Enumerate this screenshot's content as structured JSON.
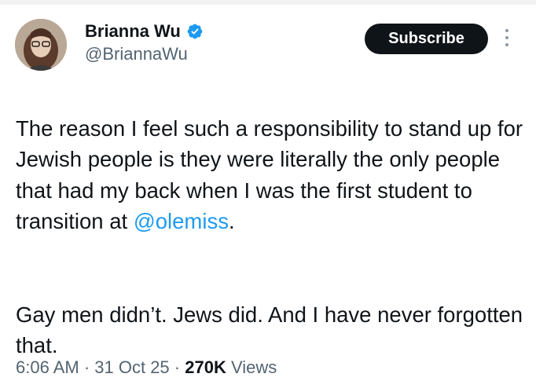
{
  "author": {
    "name": "Brianna Wu",
    "handle": "@BriannaWu",
    "verified_icon": "verified-badge-icon",
    "verified_color": "#1d9bf0"
  },
  "actions": {
    "subscribe_label": "Subscribe",
    "more_icon": "more-vertical-icon"
  },
  "tweet": {
    "para1_text": "The reason I feel such a responsibility to stand up for Jewish people is they were literally the only people that had my back when I was the first student to transition at ",
    "mention": "@olemiss",
    "para1_end": ".",
    "para2_text": "Gay men didn’t. Jews did. And I have never forgotten that."
  },
  "meta": {
    "time": "6:06 AM",
    "sep1": " · ",
    "date": "31 Oct 25",
    "sep2": " · ",
    "views_count": "270K",
    "views_label": " Views"
  },
  "colors": {
    "text": "#0f1419",
    "secondary": "#536471",
    "link": "#1d9bf0",
    "button_bg": "#0f1419"
  }
}
